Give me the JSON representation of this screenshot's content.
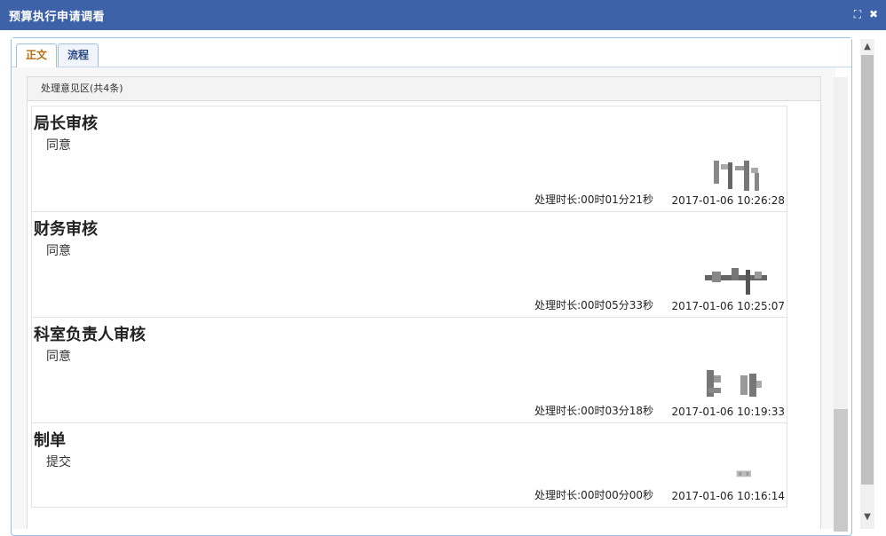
{
  "window": {
    "title": "预算执行申请调看",
    "icons": [
      "maximize-icon",
      "close-icon"
    ],
    "maximize_glyph": "⛶",
    "close_glyph": "✖"
  },
  "tabs": [
    {
      "label": "正文",
      "active": true
    },
    {
      "label": "流程",
      "active": false
    }
  ],
  "section": {
    "header": "处理意见区(共4条)"
  },
  "records": [
    {
      "title": "局长审核",
      "opinion": "同意",
      "duration": "处理时长:00时01分21秒",
      "datetime": "2017-01-06 10:26:28"
    },
    {
      "title": "财务审核",
      "opinion": "同意",
      "duration": "处理时长:00时05分33秒",
      "datetime": "2017-01-06 10:25:07"
    },
    {
      "title": "科室负责人审核",
      "opinion": "同意",
      "duration": "处理时长:00时03分18秒",
      "datetime": "2017-01-06 10:19:33"
    },
    {
      "title": "制单",
      "opinion": "提交",
      "duration": "处理时长:00时00分00秒",
      "datetime": "2017-01-06 10:16:14"
    }
  ],
  "outer_scroll": {
    "up_glyph": "▲",
    "down_glyph": "▼"
  },
  "colors": {
    "titlebar": "#3d62a7",
    "active_tab_text": "#b96d0f",
    "tab_text": "#2a4a86",
    "panel_border": "#9cc0e6"
  }
}
